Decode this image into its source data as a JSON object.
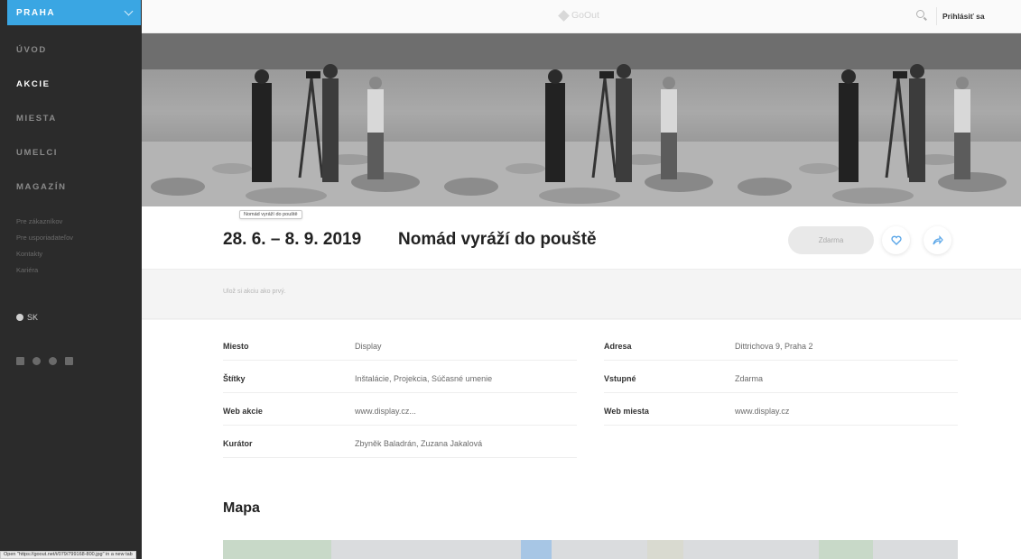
{
  "sidebar": {
    "city": "PRAHA",
    "nav": [
      {
        "label": "ÚVOD",
        "active": false
      },
      {
        "label": "AKCIE",
        "active": true
      },
      {
        "label": "MIESTA",
        "active": false
      },
      {
        "label": "UMELCI",
        "active": false
      },
      {
        "label": "MAGAZÍN",
        "active": false
      }
    ],
    "subnav": [
      "Pre zákazníkov",
      "Pre usporiadateľov",
      "Kontakty",
      "Kariéra"
    ],
    "lang": "SK",
    "social_icons": [
      "facebook-icon",
      "instagram-icon",
      "spotify-icon",
      "linkedin-icon"
    ]
  },
  "topbar": {
    "logo": "GoOut",
    "login": "Prihlásiť sa"
  },
  "event": {
    "tooltip": "Nomád vyráží do pouště",
    "date": "28. 6. – 8. 9. 2019",
    "title": "Nomád vyráží do pouště",
    "price": "Zdarma",
    "save_prompt": "Ulož si akciu ako prvý."
  },
  "details": {
    "left": [
      {
        "key": "Miesto",
        "value": "Display"
      },
      {
        "key": "Štítky",
        "value": "Inštalácie, Projekcia, Súčasné umenie"
      },
      {
        "key": "Web akcie",
        "value": "www.display.cz..."
      },
      {
        "key": "Kurátor",
        "value": "Zbyněk Baladrán, Zuzana Jakalová"
      }
    ],
    "right": [
      {
        "key": "Adresa",
        "value": "Dittrichova 9, Praha 2"
      },
      {
        "key": "Vstupné",
        "value": "Zdarma"
      },
      {
        "key": "Web miesta",
        "value": "www.display.cz"
      }
    ]
  },
  "map_title": "Mapa",
  "status_bar": "Open \"https://goout.net/i/079/799168-800.jpg\" in a new tab",
  "colors": {
    "accent": "#3aa6e3",
    "sidebar_bg": "#2b2b2b",
    "icon_blue": "#5aa6e8"
  }
}
